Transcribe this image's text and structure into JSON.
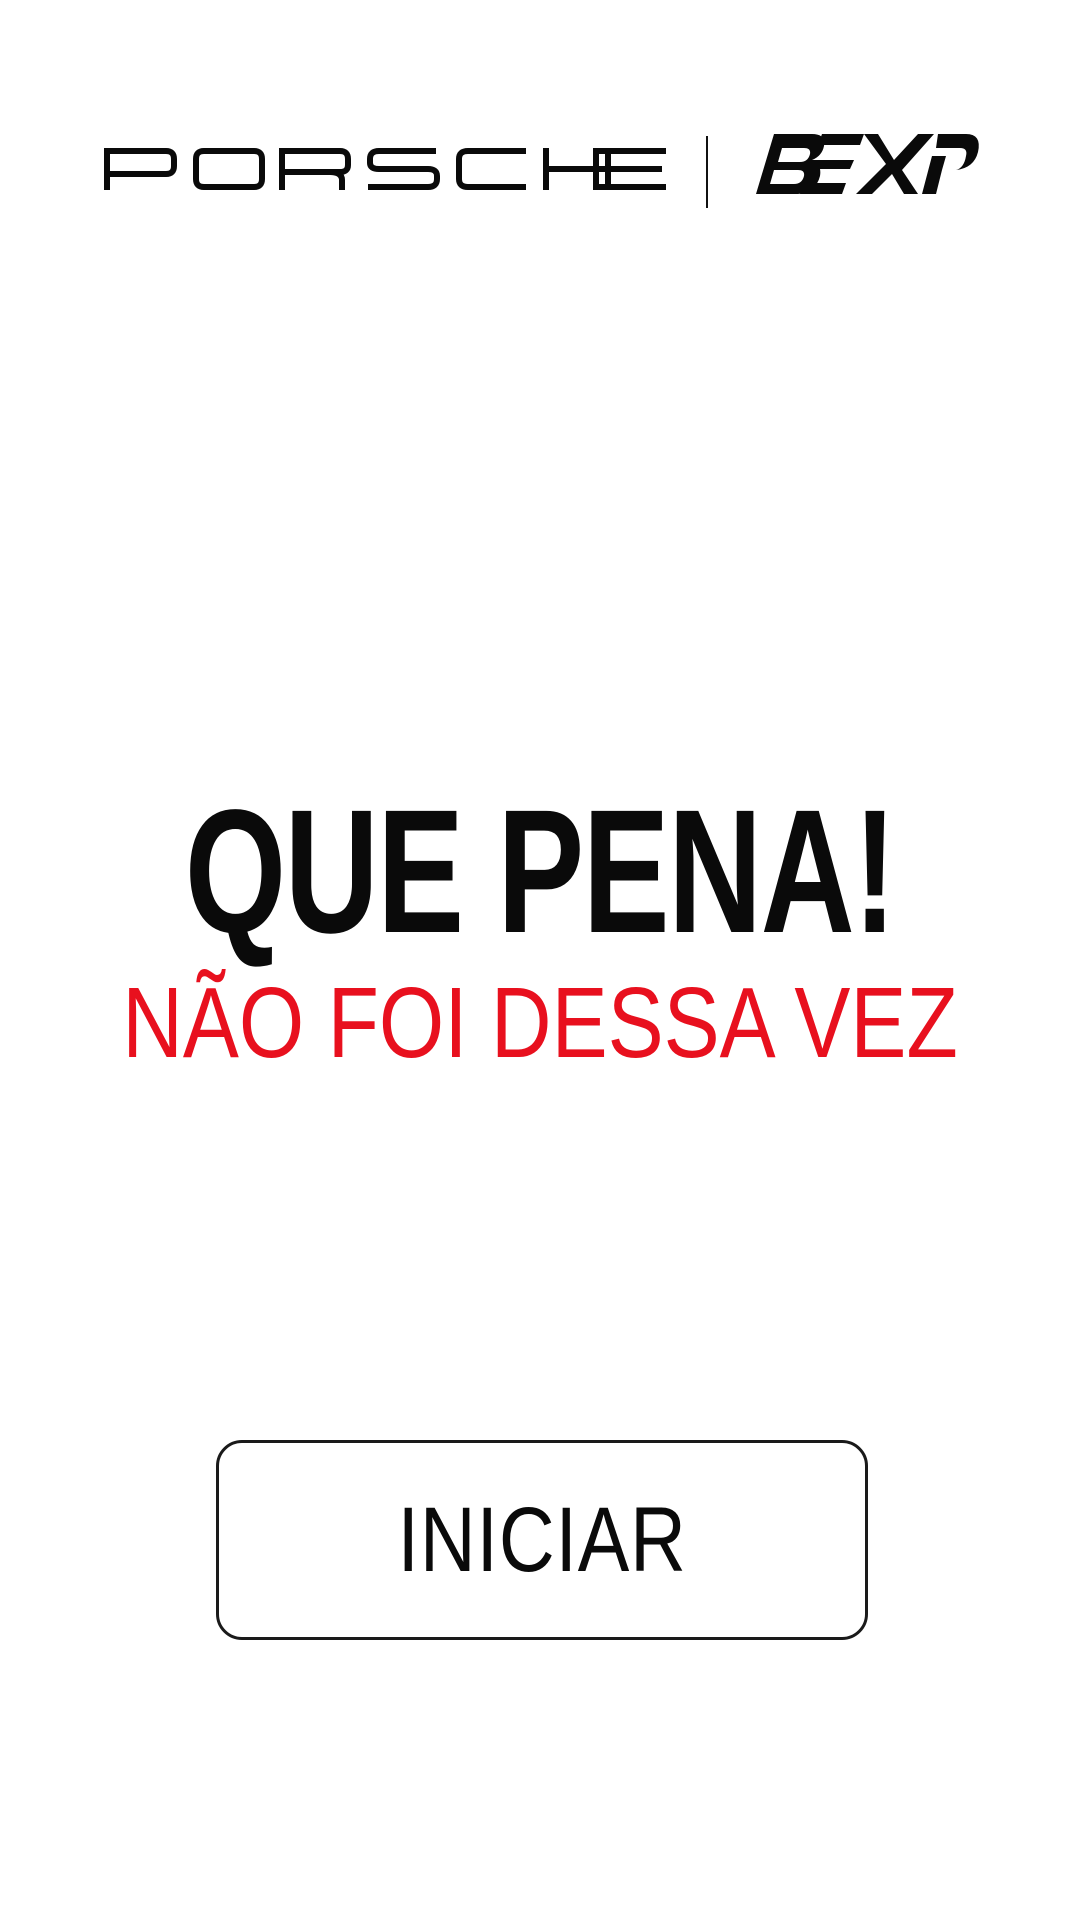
{
  "header": {
    "logo_left": "PORSCHE",
    "logo_right": "BEXP"
  },
  "result": {
    "headline": "QUE PENA!",
    "subheadline": "NÃO FOI DESSA VEZ"
  },
  "actions": {
    "start_label": "INICIAR"
  },
  "colors": {
    "background": "#ffffff",
    "text": "#0a0a0a",
    "accent": "#e8101e"
  }
}
